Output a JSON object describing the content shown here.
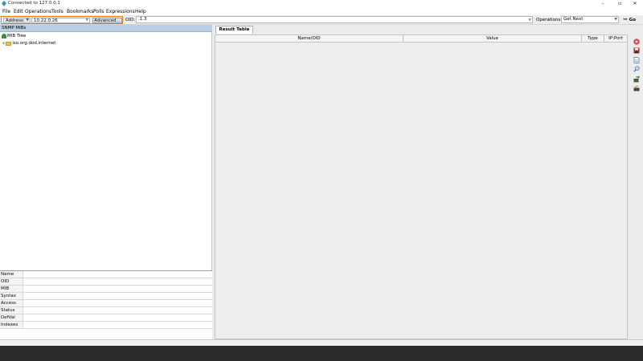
{
  "window": {
    "title": "Connected to 127.0.0.1",
    "controls": [
      "–",
      "▫",
      "✕"
    ]
  },
  "menu": [
    "File",
    "Edit",
    "Operations",
    "Tools",
    "Bookmarks",
    "Polls",
    "Expressions",
    "Help"
  ],
  "toolbar": {
    "address_label": "Address:",
    "address_value": "10.22.0.26",
    "advanced_label": "Advanced...",
    "oid_label": "OID:",
    "oid_value": ".1.3",
    "operations_label": "Operations:",
    "operation_selected": "Get Next",
    "go_label": "Go"
  },
  "tree": {
    "header": "SNMP MIBs",
    "root": "MIB Tree",
    "child": "iso.org.dod.internet"
  },
  "properties": [
    "Name",
    "OID",
    "MIB",
    "Syntax",
    "Access",
    "Status",
    "DefVal",
    "Indexes"
  ],
  "result": {
    "tab": "Result Table",
    "columns": [
      "Name/OID",
      "Value",
      "Type",
      "IP:Port"
    ]
  },
  "side_tools": [
    {
      "icon": "stop-icon",
      "color": "#d9302c"
    },
    {
      "icon": "save-icon",
      "color": "#b52a2a"
    },
    {
      "icon": "document-icon",
      "color": "#4a6fa5"
    },
    {
      "icon": "search-icon",
      "color": "#3a6ea5"
    },
    {
      "icon": "export-icon",
      "color": "#2e7d32"
    },
    {
      "icon": "edit-icon",
      "color": "#c9a227"
    }
  ]
}
